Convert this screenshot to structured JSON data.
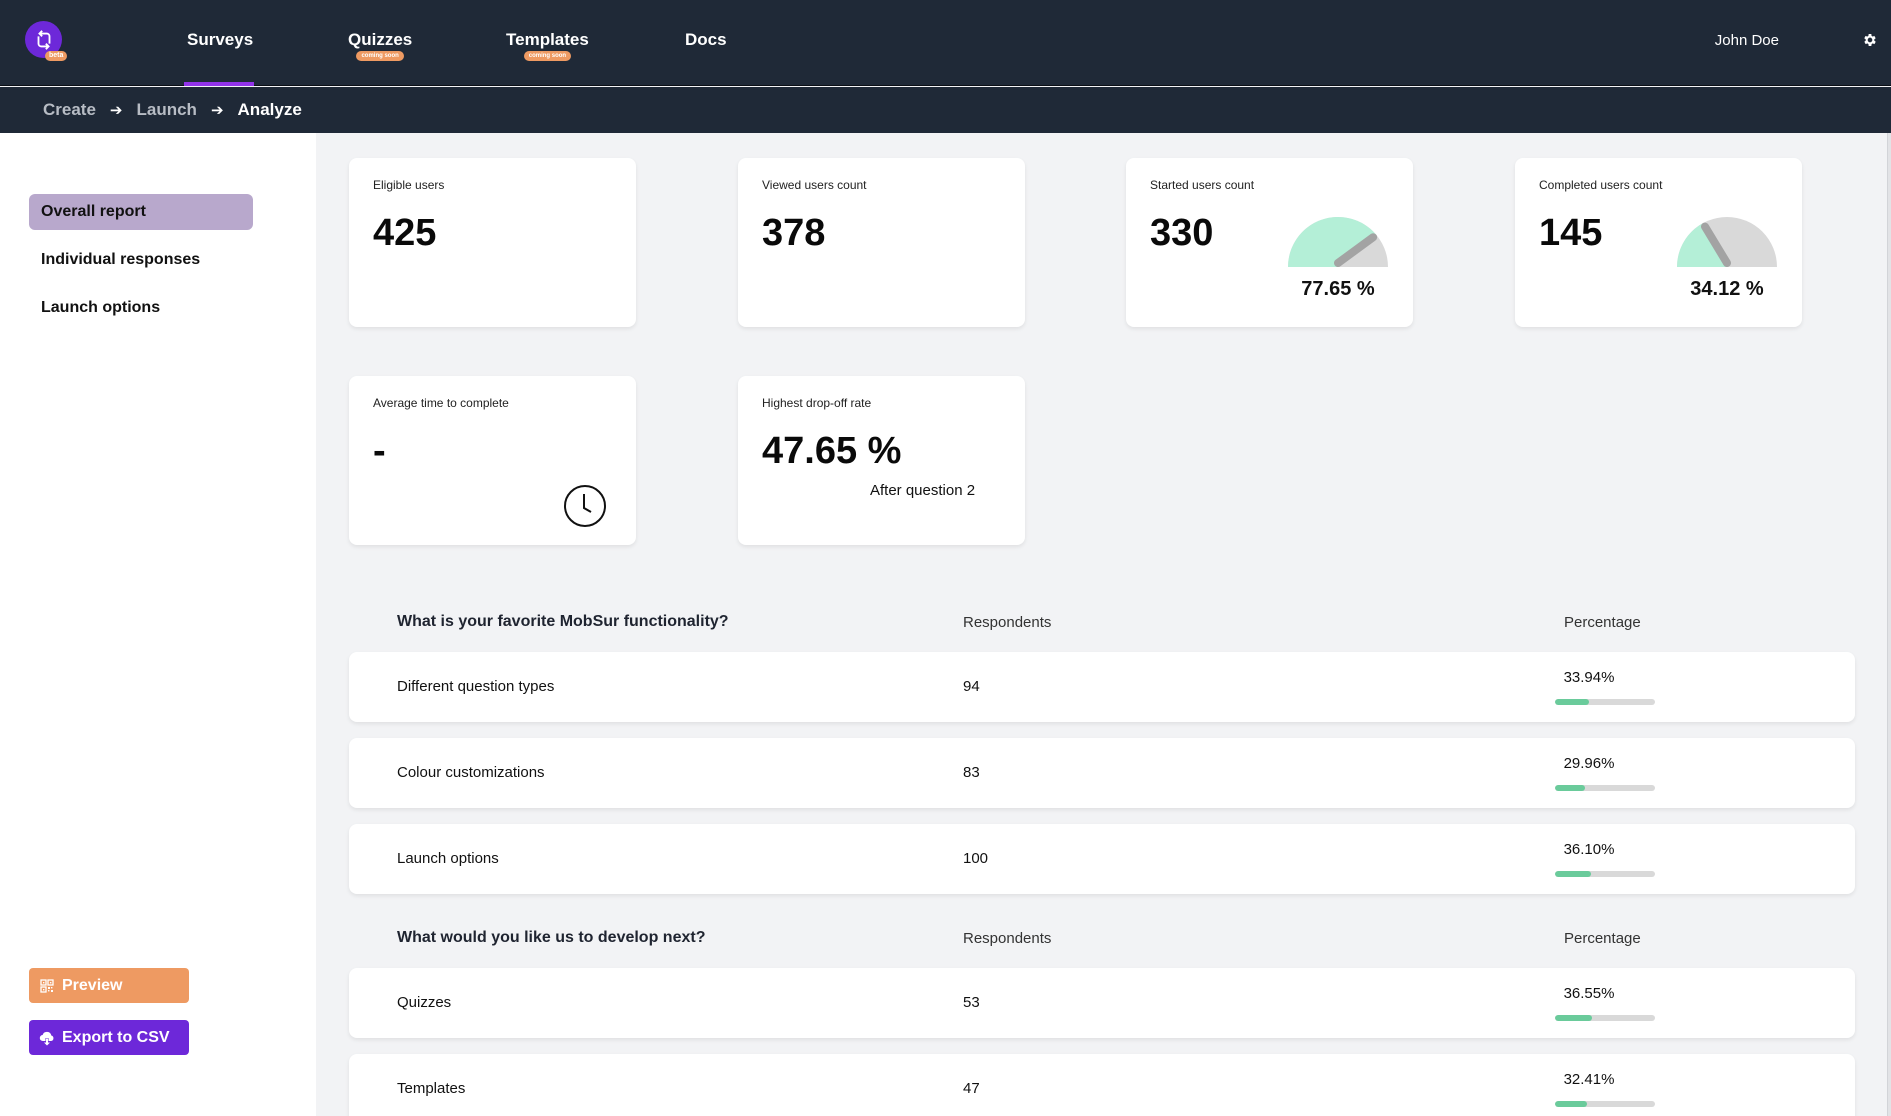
{
  "header": {
    "logo_badge": "beta",
    "nav": [
      {
        "label": "Surveys",
        "badge": null,
        "active": true
      },
      {
        "label": "Quizzes",
        "badge": "coming soon",
        "active": false
      },
      {
        "label": "Templates",
        "badge": "coming soon",
        "active": false
      },
      {
        "label": "Docs",
        "badge": null,
        "active": false
      }
    ],
    "user_name": "John Doe",
    "settings_icon": "gear-icon"
  },
  "breadcrumb": [
    {
      "label": "Create",
      "active": false
    },
    {
      "label": "Launch",
      "active": false
    },
    {
      "label": "Analyze",
      "active": true
    }
  ],
  "sidebar": {
    "items": [
      {
        "label": "Overall report",
        "active": true
      },
      {
        "label": "Individual responses",
        "active": false
      },
      {
        "label": "Launch options",
        "active": false
      }
    ],
    "preview_label": "Preview",
    "export_label": "Export to CSV"
  },
  "stats": [
    {
      "label": "Eligible users",
      "value": "425"
    },
    {
      "label": "Viewed users count",
      "value": "378"
    },
    {
      "label": "Started users count",
      "value": "330",
      "gauge_percent": 77.65,
      "gauge_label": "77.65 %"
    },
    {
      "label": "Completed users count",
      "value": "145",
      "gauge_percent": 34.12,
      "gauge_label": "34.12 %"
    },
    {
      "label": "Average time to complete",
      "value": "-"
    },
    {
      "label": "Highest drop-off rate",
      "value": "47.65 %",
      "note": "After question 2"
    }
  ],
  "colors": {
    "gauge_fill": "#b4efd7",
    "gauge_rest": "#d9d9d9",
    "bar_fill": "#6acb9b",
    "accent_purple": "#6d28d9",
    "accent_orange": "#ee9a62"
  },
  "questions": [
    {
      "title": "What is your favorite MobSur functionality?",
      "col_respondents": "Respondents",
      "col_percentage": "Percentage",
      "rows": [
        {
          "label": "Different question types",
          "count": "94",
          "percent": 33.94,
          "percent_label": "33.94%"
        },
        {
          "label": "Colour customizations",
          "count": "83",
          "percent": 29.96,
          "percent_label": "29.96%"
        },
        {
          "label": "Launch options",
          "count": "100",
          "percent": 36.1,
          "percent_label": "36.10%"
        }
      ]
    },
    {
      "title": "What would you like us to develop next?",
      "col_respondents": "Respondents",
      "col_percentage": "Percentage",
      "rows": [
        {
          "label": "Quizzes",
          "count": "53",
          "percent": 36.55,
          "percent_label": "36.55%"
        },
        {
          "label": "Templates",
          "count": "47",
          "percent": 32.41,
          "percent_label": "32.41%"
        }
      ]
    }
  ]
}
